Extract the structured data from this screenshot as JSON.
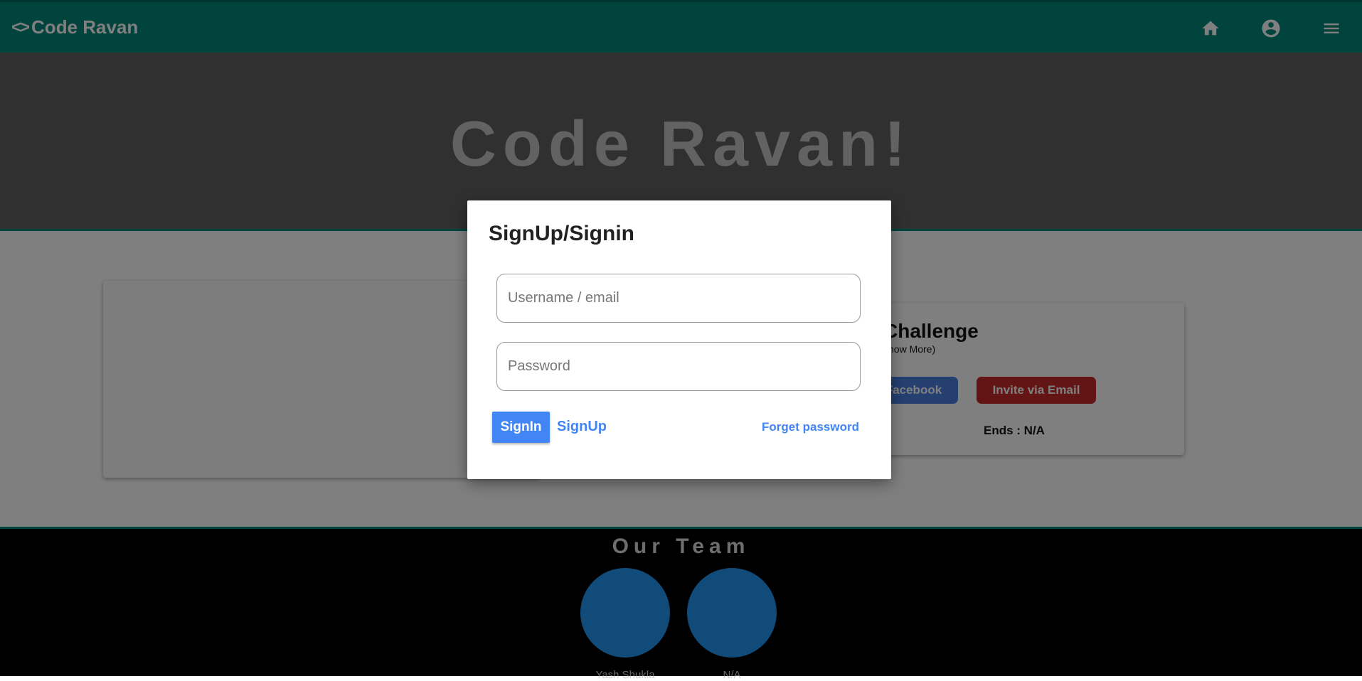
{
  "navbar": {
    "brand_icon": "<>",
    "brand_title": "Code Ravan",
    "icons": [
      "home-icon",
      "account-circle-icon",
      "menu-icon"
    ]
  },
  "hero": {
    "title": "Code Ravan!"
  },
  "challenge_card": {
    "title": "Challenge",
    "subtitle": "(Show More)",
    "facebook_button": "Facebook",
    "email_button": "Invite via Email",
    "ends": "Ends : N/A"
  },
  "team": {
    "title": "Our Team",
    "members": [
      {
        "name": "Yash Shukla"
      },
      {
        "name": "N/A"
      }
    ]
  },
  "modal": {
    "title": "SignUp/Signin",
    "username_placeholder": "Username / email",
    "password_placeholder": "Password",
    "signin_label": "SignIn",
    "signup_label": "SignUp",
    "forget_label": "Forget password"
  },
  "colors": {
    "navbar": "#00897b",
    "hero": "#616161",
    "primary_blue": "#4285f4",
    "facebook": "#4a7ee0",
    "email_red": "#c62828",
    "avatar": "#2196f3"
  }
}
